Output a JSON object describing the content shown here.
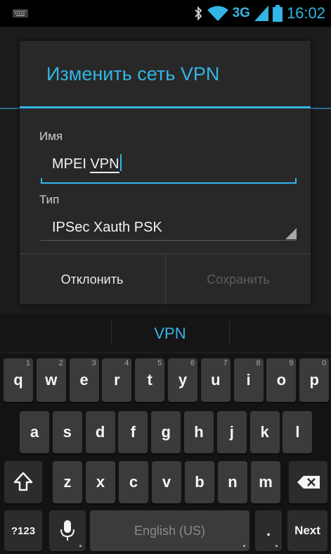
{
  "status_bar": {
    "time": "16:02",
    "network": "3G"
  },
  "dialog": {
    "title": "Изменить сеть VPN",
    "name_label": "Имя",
    "name_value_prefix": "MPEI ",
    "name_value_word": "VPN",
    "type_label": "Тип",
    "type_value": "IPSec Xauth PSK",
    "cancel_label": "Отклонить",
    "save_label": "Сохранить"
  },
  "keyboard": {
    "suggestion": "VPN",
    "row1": [
      {
        "key": "q",
        "hint": "1"
      },
      {
        "key": "w",
        "hint": "2"
      },
      {
        "key": "e",
        "hint": "3"
      },
      {
        "key": "r",
        "hint": "4"
      },
      {
        "key": "t",
        "hint": "5"
      },
      {
        "key": "y",
        "hint": "6"
      },
      {
        "key": "u",
        "hint": "7"
      },
      {
        "key": "i",
        "hint": "8"
      },
      {
        "key": "o",
        "hint": "9"
      },
      {
        "key": "p",
        "hint": "0"
      }
    ],
    "row2": [
      "a",
      "s",
      "d",
      "f",
      "g",
      "h",
      "j",
      "k",
      "l"
    ],
    "row3": [
      "z",
      "x",
      "c",
      "v",
      "b",
      "n",
      "m"
    ],
    "symbols_label": "?123",
    "space_label": "English (US)",
    "period_label": ".",
    "enter_label": "Next"
  },
  "colors": {
    "accent": "#33b5e5",
    "dialog_bg": "#282828",
    "key_bg": "#3a3b3c"
  },
  "icons": [
    "keyboard-notification-icon",
    "bluetooth-icon",
    "wifi-icon",
    "signal-icon",
    "battery-icon",
    "shift-icon",
    "backspace-icon",
    "microphone-icon"
  ]
}
